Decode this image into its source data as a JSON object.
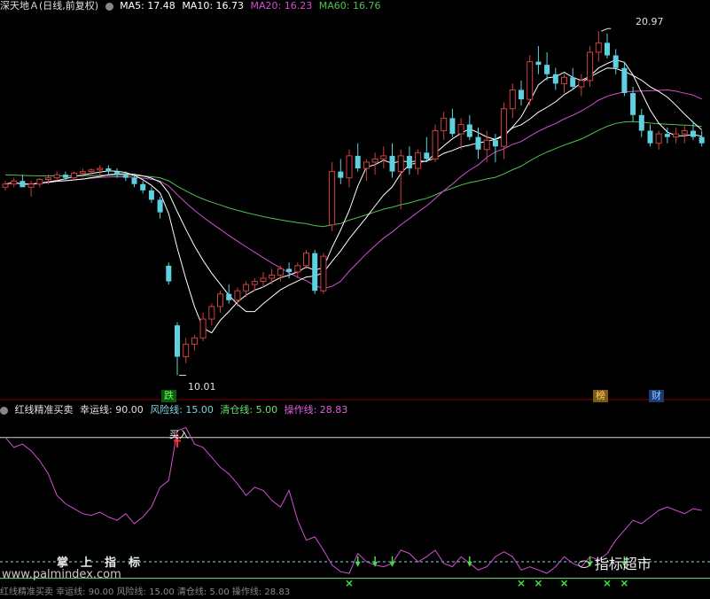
{
  "header": {
    "stock_title": "深天地Ａ(日线,前复权)",
    "ma5": "MA5: 17.48",
    "ma10": "MA10: 16.73",
    "ma20": "MA20: 16.23",
    "ma60": "MA60: 16.76",
    "colors": {
      "ma5": "#ffffff",
      "ma10": "#ffffff",
      "ma20": "#d050d0",
      "ma60": "#50c050"
    }
  },
  "price_labels": {
    "high": "20.97",
    "low": "10.01"
  },
  "badges": {
    "drop": "跌",
    "list": "榜",
    "finance": "财"
  },
  "indicator": {
    "name": "红线精准买卖",
    "lucky": "幸运线: 90.00",
    "risk": "风险线: 15.00",
    "clear": "清仓线: 5.00",
    "operate": "操作线: 28.83",
    "buy_label": "买入",
    "bottom_partial": "红线精准买卖 幸运线: 90.00  风险线: 15.00  清仓线: 5.00  操作线: 28.83"
  },
  "watermark": {
    "title": "掌上指标",
    "url": "www.palmindex.com",
    "brand": "指标超市"
  },
  "chart_data": {
    "type": "line",
    "candles": [
      [
        0,
        16.0,
        16.2,
        15.9,
        16.1
      ],
      [
        1,
        16.1,
        16.3,
        16.0,
        16.2
      ],
      [
        2,
        16.2,
        16.4,
        16.1,
        16.0
      ],
      [
        3,
        16.0,
        16.2,
        15.7,
        16.1
      ],
      [
        4,
        16.1,
        16.3,
        16.0,
        16.25
      ],
      [
        5,
        16.25,
        16.4,
        16.1,
        16.3
      ],
      [
        6,
        16.3,
        16.5,
        16.2,
        16.4
      ],
      [
        7,
        16.4,
        16.5,
        16.2,
        16.3
      ],
      [
        8,
        16.3,
        16.5,
        16.2,
        16.45
      ],
      [
        9,
        16.45,
        16.6,
        16.3,
        16.5
      ],
      [
        10,
        16.5,
        16.6,
        16.4,
        16.55
      ],
      [
        11,
        16.55,
        16.7,
        16.4,
        16.6
      ],
      [
        12,
        16.6,
        16.7,
        16.4,
        16.5
      ],
      [
        13,
        16.5,
        16.6,
        16.3,
        16.4
      ],
      [
        14,
        16.4,
        16.5,
        16.2,
        16.3
      ],
      [
        15,
        16.3,
        16.4,
        16.0,
        16.1
      ],
      [
        16,
        16.1,
        16.2,
        15.8,
        15.9
      ],
      [
        17,
        15.9,
        16.0,
        15.5,
        15.6
      ],
      [
        18,
        15.6,
        15.7,
        15.0,
        15.2
      ],
      [
        19,
        13.5,
        13.6,
        12.9,
        13.0
      ],
      [
        20,
        11.6,
        11.7,
        10.01,
        10.6
      ],
      [
        21,
        10.6,
        11.2,
        10.4,
        11.0
      ],
      [
        22,
        11.0,
        11.3,
        10.8,
        11.2
      ],
      [
        23,
        11.2,
        12.0,
        11.1,
        11.8
      ],
      [
        24,
        11.8,
        12.3,
        11.6,
        12.2
      ],
      [
        25,
        12.2,
        12.7,
        12.0,
        12.6
      ],
      [
        26,
        12.6,
        12.9,
        12.3,
        12.4
      ],
      [
        27,
        12.4,
        12.8,
        12.2,
        12.7
      ],
      [
        28,
        12.7,
        13.0,
        12.5,
        12.9
      ],
      [
        29,
        12.9,
        13.1,
        12.7,
        13.0
      ],
      [
        30,
        13.0,
        13.3,
        12.8,
        13.1
      ],
      [
        31,
        13.1,
        13.4,
        12.9,
        13.2
      ],
      [
        32,
        13.2,
        13.5,
        13.0,
        13.4
      ],
      [
        33,
        13.4,
        13.6,
        13.1,
        13.3
      ],
      [
        34,
        13.3,
        13.6,
        13.1,
        13.5
      ],
      [
        35,
        13.5,
        14.0,
        13.4,
        13.9
      ],
      [
        36,
        13.9,
        14.0,
        12.6,
        12.7
      ],
      [
        37,
        12.7,
        13.9,
        12.6,
        13.8
      ],
      [
        38,
        14.8,
        16.8,
        14.6,
        16.5
      ],
      [
        39,
        16.5,
        16.9,
        16.1,
        16.3
      ],
      [
        40,
        16.3,
        17.2,
        16.0,
        17.0
      ],
      [
        41,
        17.0,
        17.4,
        16.5,
        16.6
      ],
      [
        42,
        16.6,
        16.9,
        16.2,
        16.8
      ],
      [
        43,
        16.8,
        17.1,
        16.4,
        16.9
      ],
      [
        44,
        16.9,
        17.3,
        16.6,
        17.0
      ],
      [
        45,
        17.0,
        17.4,
        16.3,
        16.5
      ],
      [
        46,
        16.5,
        17.2,
        15.3,
        17.0
      ],
      [
        47,
        17.0,
        17.3,
        16.4,
        16.6
      ],
      [
        48,
        16.6,
        17.2,
        16.4,
        17.1
      ],
      [
        49,
        17.1,
        17.6,
        16.8,
        16.9
      ],
      [
        50,
        16.9,
        18.0,
        16.8,
        17.8
      ],
      [
        51,
        17.8,
        18.4,
        17.5,
        18.2
      ],
      [
        52,
        18.2,
        18.5,
        17.6,
        17.7
      ],
      [
        53,
        17.7,
        18.2,
        17.2,
        18.0
      ],
      [
        54,
        18.0,
        18.3,
        17.5,
        17.6
      ],
      [
        55,
        17.6,
        17.9,
        16.9,
        17.2
      ],
      [
        56,
        17.2,
        17.8,
        16.8,
        17.5
      ],
      [
        57,
        17.5,
        17.7,
        16.8,
        17.3
      ],
      [
        58,
        17.3,
        18.7,
        16.9,
        18.5
      ],
      [
        59,
        18.5,
        19.3,
        18.2,
        19.1
      ],
      [
        60,
        19.1,
        19.4,
        18.6,
        18.8
      ],
      [
        61,
        18.8,
        20.2,
        18.6,
        20.0
      ],
      [
        62,
        20.0,
        20.5,
        19.6,
        19.9
      ],
      [
        63,
        19.9,
        20.3,
        19.4,
        19.6
      ],
      [
        64,
        19.6,
        19.8,
        19.1,
        19.3
      ],
      [
        65,
        19.3,
        19.6,
        19.0,
        19.5
      ],
      [
        66,
        19.5,
        19.8,
        19.1,
        19.2
      ],
      [
        67,
        19.2,
        19.6,
        18.9,
        19.4
      ],
      [
        68,
        19.4,
        20.5,
        19.2,
        20.3
      ],
      [
        69,
        20.3,
        20.97,
        20.0,
        20.6
      ],
      [
        70,
        20.6,
        20.9,
        20.1,
        20.2
      ],
      [
        71,
        20.2,
        20.4,
        19.6,
        19.8
      ],
      [
        72,
        19.8,
        20.0,
        18.9,
        19.0
      ],
      [
        73,
        19.0,
        19.2,
        18.1,
        18.3
      ],
      [
        74,
        18.3,
        18.5,
        17.6,
        17.8
      ],
      [
        75,
        17.8,
        18.0,
        17.3,
        17.4
      ],
      [
        76,
        17.4,
        17.8,
        17.2,
        17.7
      ],
      [
        77,
        17.7,
        17.9,
        17.4,
        17.6
      ],
      [
        78,
        17.6,
        17.9,
        17.4,
        17.7
      ],
      [
        79,
        17.7,
        18.0,
        17.4,
        17.8
      ],
      [
        80,
        17.8,
        18.1,
        17.5,
        17.6
      ],
      [
        81,
        17.6,
        17.8,
        17.3,
        17.4
      ]
    ],
    "indicator_values": [
      90,
      84,
      86,
      82,
      76,
      68,
      55,
      50,
      47,
      44,
      43,
      45,
      42,
      40,
      44,
      38,
      42,
      48,
      60,
      64,
      94,
      96,
      86,
      84,
      78,
      72,
      68,
      62,
      55,
      60,
      58,
      52,
      48,
      58,
      40,
      28,
      30,
      22,
      13,
      9,
      8,
      20,
      15,
      13,
      12,
      14,
      22,
      20,
      15,
      18,
      22,
      14,
      12,
      18,
      14,
      10,
      12,
      18,
      21,
      18,
      10,
      12,
      10,
      8,
      12,
      18,
      14,
      12,
      18,
      16,
      20,
      28,
      34,
      40,
      38,
      42,
      46,
      48,
      46,
      44,
      47,
      46
    ],
    "series": [
      {
        "name": "MA5"
      },
      {
        "name": "MA10"
      },
      {
        "name": "MA20"
      },
      {
        "name": "MA60"
      }
    ],
    "levels": {
      "lucky": 90,
      "risk": 15,
      "clear": 5
    }
  }
}
